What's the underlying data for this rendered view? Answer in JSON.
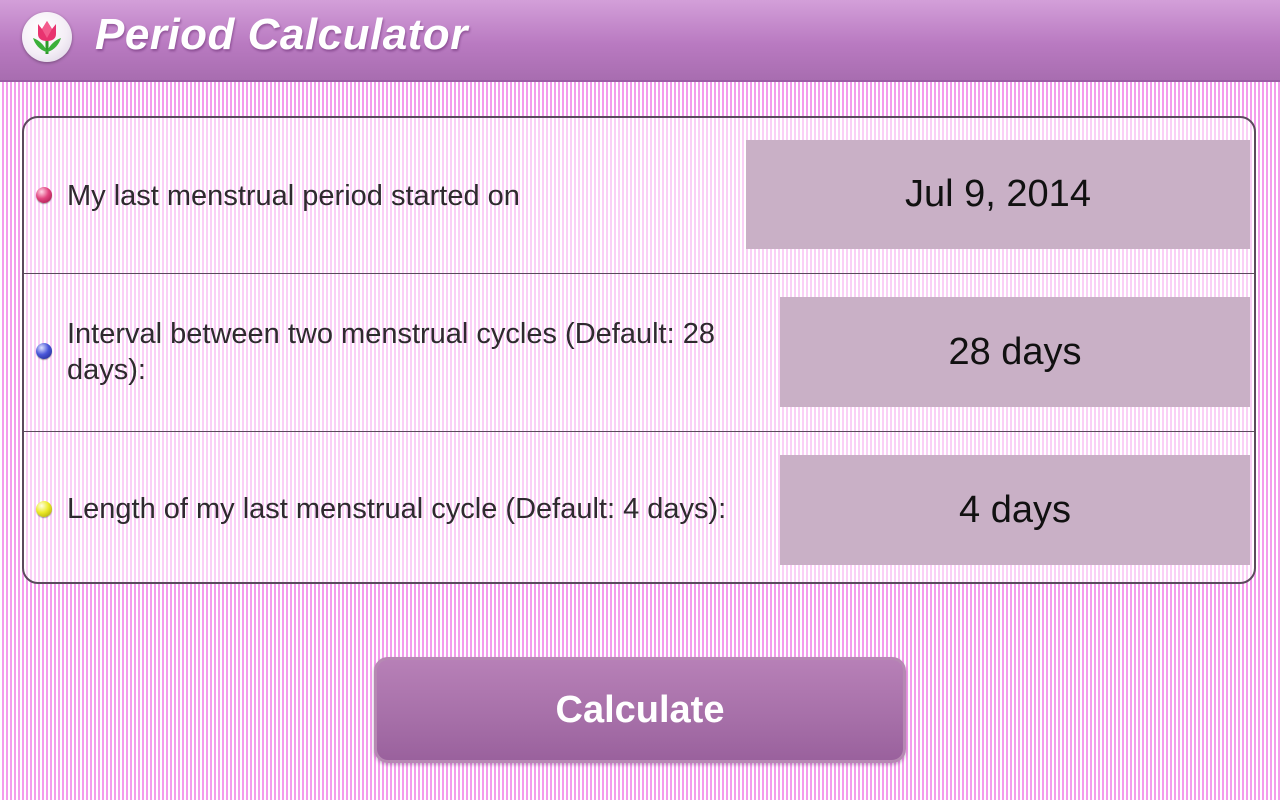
{
  "app": {
    "title": "Period Calculator",
    "icon": "tulip-icon"
  },
  "form": {
    "rows": [
      {
        "bullet_color": "#e2457f",
        "label": "My last menstrual period started on",
        "value": "Jul 9, 2014"
      },
      {
        "bullet_color": "#4a57d9",
        "label": "Interval between two menstrual cycles (Default: 28 days):",
        "value": "28 days"
      },
      {
        "bullet_color": "#ecea2a",
        "label": "Length of my last menstrual cycle (Default: 4 days):",
        "value": "4 days"
      }
    ]
  },
  "actions": {
    "calculate_label": "Calculate"
  },
  "colors": {
    "titlebar": "#b97ac1",
    "background_stripe": "#f39cec",
    "value_box": "#c9b0c6",
    "button": "#a66fa8"
  }
}
